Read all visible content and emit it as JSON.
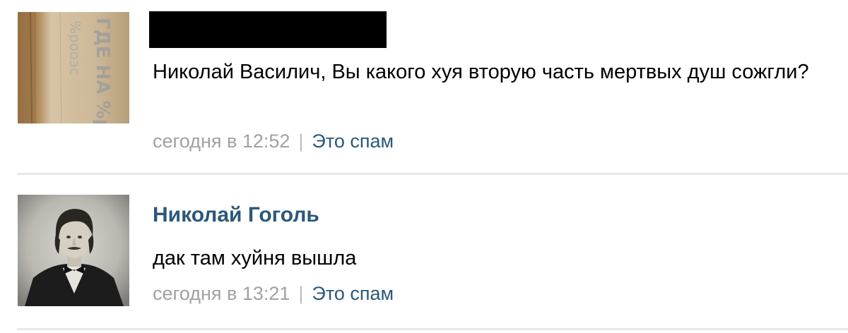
{
  "comments": [
    {
      "author": "",
      "author_redacted": true,
      "avatar_text": "ГДЕ НА\n%рооэс",
      "text": "Николай Василич, Вы какого хуя вторую часть мертвых душ сожгли?",
      "date": "сегодня в 12:52",
      "separator": "|",
      "spam_label": "Это спам"
    },
    {
      "author": "Николай Гоголь",
      "author_redacted": false,
      "text": "дак там хуйня вышла",
      "date": "сегодня в 13:21",
      "separator": "|",
      "spam_label": "Это спам"
    }
  ],
  "colors": {
    "link": "#2b587a",
    "meta": "#a1a1a1",
    "divider": "#e8e8e8",
    "redaction": "#000000"
  }
}
